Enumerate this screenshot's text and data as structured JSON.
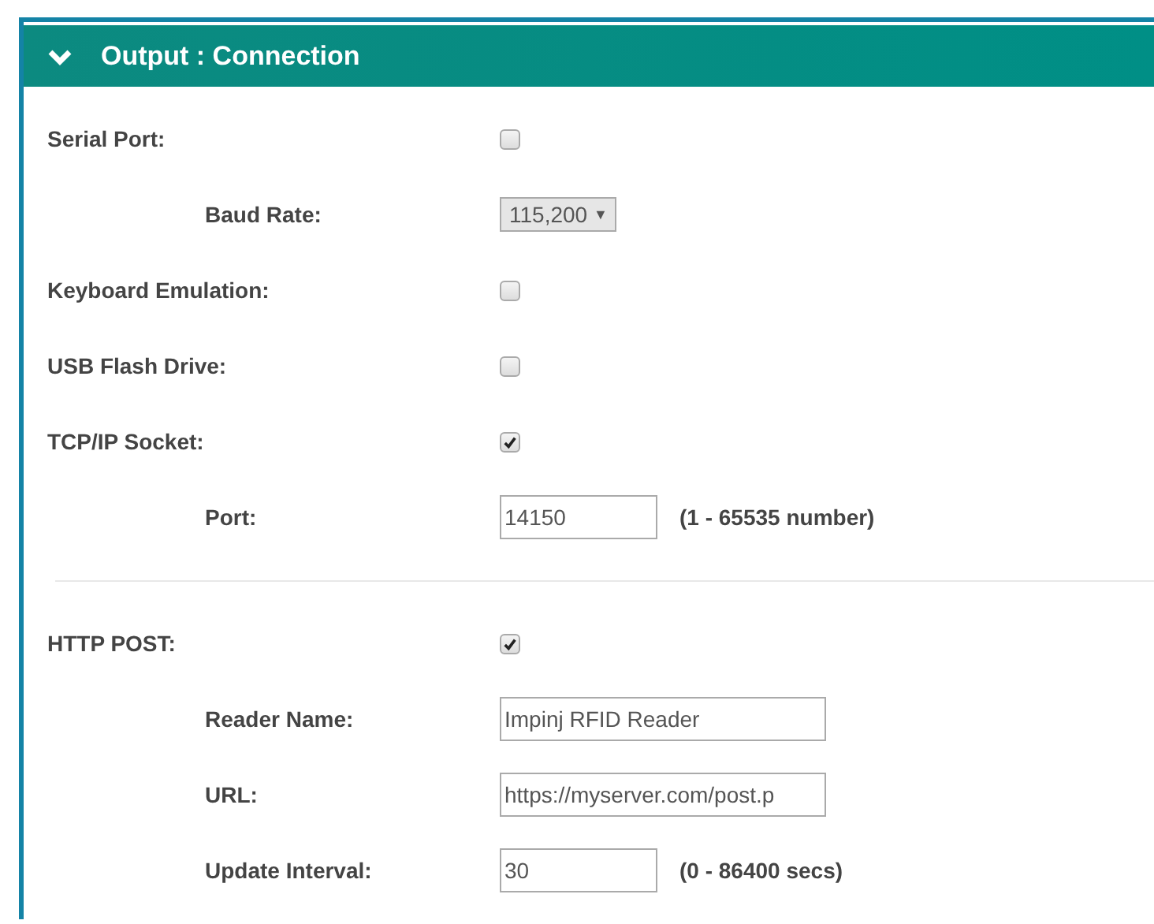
{
  "panel": {
    "title": "Output : Connection",
    "expanded": true
  },
  "sections": [
    {
      "rows": [
        {
          "label": "Serial Port:",
          "kind": "checkbox",
          "checked": false,
          "children": [
            {
              "label": "Baud Rate:",
              "kind": "select",
              "value": "115,200",
              "caret": "▼"
            }
          ]
        },
        {
          "label": "Keyboard Emulation:",
          "kind": "checkbox",
          "checked": false
        },
        {
          "label": "USB Flash Drive:",
          "kind": "checkbox",
          "checked": false
        },
        {
          "label": "TCP/IP Socket:",
          "kind": "checkbox",
          "checked": true,
          "children": [
            {
              "label": "Port:",
              "kind": "text",
              "value": "14150",
              "hint": "(1 - 65535 number)"
            }
          ]
        }
      ]
    },
    {
      "rows": [
        {
          "label": "HTTP POST:",
          "kind": "checkbox",
          "checked": true,
          "children": [
            {
              "label": "Reader Name:",
              "kind": "text",
              "value": "Impinj RFID Reader"
            },
            {
              "label": "URL:",
              "kind": "text",
              "value": "https://myserver.com/post.p"
            },
            {
              "label": "Update Interval:",
              "kind": "text",
              "value": "30",
              "hint": "(0 - 86400 secs)"
            }
          ]
        }
      ]
    }
  ]
}
